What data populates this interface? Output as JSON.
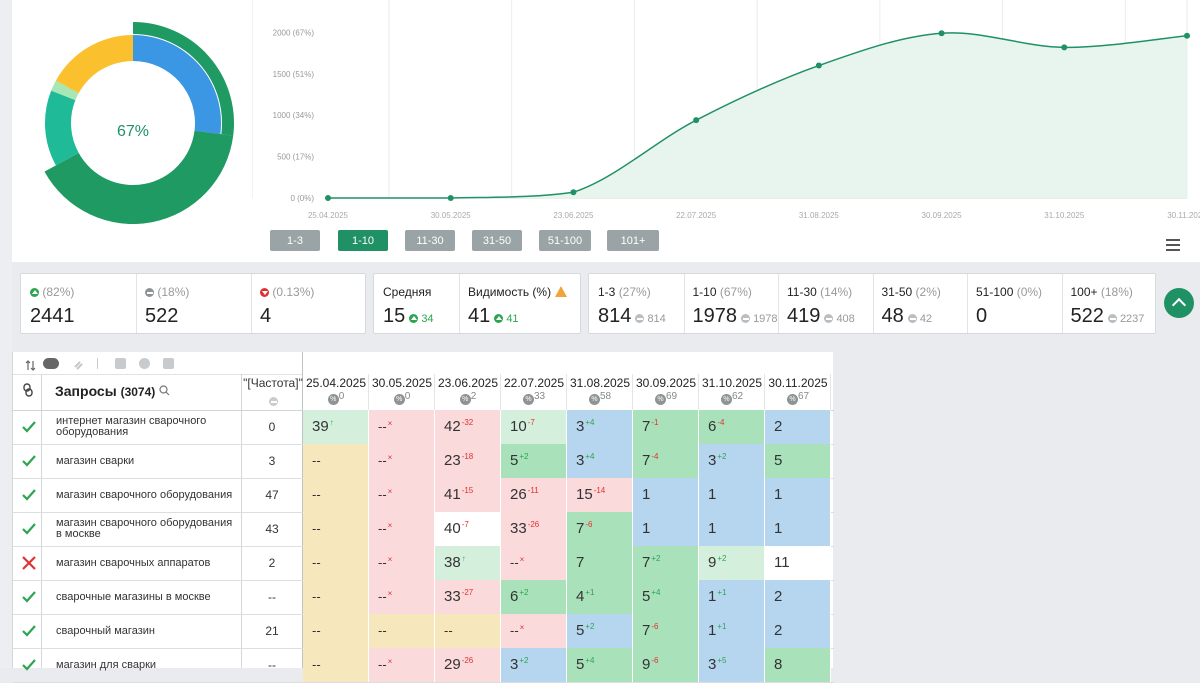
{
  "donut": {
    "center_label": "67%",
    "segments": [
      {
        "name": "1-3",
        "value": 27,
        "color": "#3b97e3"
      },
      {
        "name": "1-10",
        "value": 40,
        "color": "#1f9a62"
      },
      {
        "name": "11-30",
        "value": 14,
        "color": "#1fba98"
      },
      {
        "name": "31-50",
        "value": 2,
        "color": "#a8e6b4"
      },
      {
        "name": "51-100",
        "value": 17,
        "color": "#fbc02d"
      }
    ]
  },
  "chart_data": {
    "type": "area",
    "x": [
      "25.04.2025",
      "30.05.2025",
      "23.06.2025",
      "22.07.2025",
      "31.08.2025",
      "30.09.2025",
      "31.10.2025",
      "30.11.2025"
    ],
    "values": [
      0,
      0,
      70,
      940,
      1600,
      1990,
      1820,
      1960
    ],
    "y_ticks": [
      "0 (0%)",
      "500 (17%)",
      "1000 (34%)",
      "1500 (51%)",
      "2000 (67%)"
    ],
    "y_tick_values": [
      0,
      500,
      1000,
      1500,
      2000
    ],
    "ylim": [
      0,
      2150
    ],
    "grid": true,
    "line_color": "#1f9165",
    "fill_color": "#e8f5ee"
  },
  "range_buttons": [
    "1-3",
    "1-10",
    "11-30",
    "31-50",
    "51-100",
    "101+"
  ],
  "active_range": "1-10",
  "stats_left": [
    {
      "icon": "up",
      "pct": "(82%)",
      "value": "2441"
    },
    {
      "icon": "eq",
      "pct": "(18%)",
      "value": "522"
    },
    {
      "icon": "dn",
      "pct": "(0.13%)",
      "value": "4"
    }
  ],
  "stats_mid": [
    {
      "label": "Средняя",
      "value": "15",
      "delta": "34"
    },
    {
      "label": "Видимость (%)",
      "value": "41",
      "delta": "41"
    }
  ],
  "stats_ranges": [
    {
      "label": "1-3",
      "pct": "(27%)",
      "value": "814",
      "prev": "814"
    },
    {
      "label": "1-10",
      "pct": "(67%)",
      "value": "1978",
      "prev": "1978"
    },
    {
      "label": "11-30",
      "pct": "(14%)",
      "value": "419",
      "prev": "408"
    },
    {
      "label": "31-50",
      "pct": "(2%)",
      "value": "48",
      "prev": "42"
    },
    {
      "label": "51-100",
      "pct": "(0%)",
      "value": "0",
      "prev": ""
    },
    {
      "label": "100+",
      "pct": "(18%)",
      "value": "522",
      "prev": "2237"
    }
  ],
  "table": {
    "queries_label": "Запросы",
    "queries_count": "(3074)",
    "freq_header": "\"[Частота]\"",
    "dates": [
      {
        "date": "25.04.2025",
        "sub": "0"
      },
      {
        "date": "30.05.2025",
        "sub": "0"
      },
      {
        "date": "23.06.2025",
        "sub": "2"
      },
      {
        "date": "22.07.2025",
        "sub": "33"
      },
      {
        "date": "31.08.2025",
        "sub": "58"
      },
      {
        "date": "30.09.2025",
        "sub": "69"
      },
      {
        "date": "31.10.2025",
        "sub": "62"
      },
      {
        "date": "30.11.2025",
        "sub": "67"
      }
    ],
    "rows": [
      {
        "status": "ok",
        "keyword": "интернет магазин сварочного оборудования",
        "freq": "0",
        "cells": [
          {
            "v": "39",
            "d": "↑",
            "dc": "g",
            "c": "lgr"
          },
          {
            "v": "--",
            "d": "×",
            "dc": "r",
            "c": "red"
          },
          {
            "v": "42",
            "d": "-32",
            "dc": "r",
            "c": "red"
          },
          {
            "v": "10",
            "d": "-7",
            "dc": "r",
            "c": "lgr"
          },
          {
            "v": "3",
            "d": "+4",
            "dc": "g",
            "c": "blu"
          },
          {
            "v": "7",
            "d": "-1",
            "dc": "r",
            "c": "grn"
          },
          {
            "v": "6",
            "d": "-4",
            "dc": "r",
            "c": "grn"
          },
          {
            "v": "2",
            "d": "",
            "dc": "g",
            "c": "blu"
          }
        ]
      },
      {
        "status": "ok",
        "keyword": "магазин сварки",
        "freq": "3",
        "cells": [
          {
            "v": "--",
            "d": "",
            "dc": "g",
            "c": "yel"
          },
          {
            "v": "--",
            "d": "×",
            "dc": "r",
            "c": "red"
          },
          {
            "v": "23",
            "d": "-18",
            "dc": "r",
            "c": "red"
          },
          {
            "v": "5",
            "d": "+2",
            "dc": "g",
            "c": "grn"
          },
          {
            "v": "3",
            "d": "+4",
            "dc": "g",
            "c": "blu"
          },
          {
            "v": "7",
            "d": "-4",
            "dc": "r",
            "c": "grn"
          },
          {
            "v": "3",
            "d": "+2",
            "dc": "g",
            "c": "blu"
          },
          {
            "v": "5",
            "d": "",
            "dc": "g",
            "c": "grn"
          }
        ]
      },
      {
        "status": "ok",
        "keyword": "магазин сварочного оборудования",
        "freq": "47",
        "cells": [
          {
            "v": "--",
            "d": "",
            "dc": "g",
            "c": "yel"
          },
          {
            "v": "--",
            "d": "×",
            "dc": "r",
            "c": "red"
          },
          {
            "v": "41",
            "d": "-15",
            "dc": "r",
            "c": "red"
          },
          {
            "v": "26",
            "d": "-11",
            "dc": "r",
            "c": "red"
          },
          {
            "v": "15",
            "d": "-14",
            "dc": "r",
            "c": "red"
          },
          {
            "v": "1",
            "d": "",
            "dc": "g",
            "c": "blu"
          },
          {
            "v": "1",
            "d": "",
            "dc": "g",
            "c": "blu"
          },
          {
            "v": "1",
            "d": "",
            "dc": "g",
            "c": "blu"
          }
        ]
      },
      {
        "status": "ok",
        "keyword": "магазин сварочного оборудования в москве",
        "freq": "43",
        "cells": [
          {
            "v": "--",
            "d": "",
            "dc": "g",
            "c": "yel"
          },
          {
            "v": "--",
            "d": "×",
            "dc": "r",
            "c": "red"
          },
          {
            "v": "40",
            "d": "-7",
            "dc": "r",
            "c": "wht"
          },
          {
            "v": "33",
            "d": "-26",
            "dc": "r",
            "c": "red"
          },
          {
            "v": "7",
            "d": "-6",
            "dc": "r",
            "c": "grn"
          },
          {
            "v": "1",
            "d": "",
            "dc": "g",
            "c": "blu"
          },
          {
            "v": "1",
            "d": "",
            "dc": "g",
            "c": "blu"
          },
          {
            "v": "1",
            "d": "",
            "dc": "g",
            "c": "blu"
          }
        ]
      },
      {
        "status": "bad",
        "keyword": "магазин сварочных аппаратов",
        "freq": "2",
        "cells": [
          {
            "v": "--",
            "d": "",
            "dc": "g",
            "c": "yel"
          },
          {
            "v": "--",
            "d": "×",
            "dc": "r",
            "c": "red"
          },
          {
            "v": "38",
            "d": "↑",
            "dc": "g",
            "c": "lgr"
          },
          {
            "v": "--",
            "d": "×",
            "dc": "r",
            "c": "red"
          },
          {
            "v": "7",
            "d": "",
            "dc": "g",
            "c": "grn"
          },
          {
            "v": "7",
            "d": "+2",
            "dc": "g",
            "c": "grn"
          },
          {
            "v": "9",
            "d": "+2",
            "dc": "g",
            "c": "lgr"
          },
          {
            "v": "11",
            "d": "",
            "dc": "g",
            "c": "wht"
          }
        ]
      },
      {
        "status": "ok",
        "keyword": "сварочные магазины в москве",
        "freq": "--",
        "cells": [
          {
            "v": "--",
            "d": "",
            "dc": "g",
            "c": "yel"
          },
          {
            "v": "--",
            "d": "×",
            "dc": "r",
            "c": "red"
          },
          {
            "v": "33",
            "d": "-27",
            "dc": "r",
            "c": "red"
          },
          {
            "v": "6",
            "d": "+2",
            "dc": "g",
            "c": "grn"
          },
          {
            "v": "4",
            "d": "+1",
            "dc": "g",
            "c": "grn"
          },
          {
            "v": "5",
            "d": "+4",
            "dc": "g",
            "c": "grn"
          },
          {
            "v": "1",
            "d": "+1",
            "dc": "g",
            "c": "blu"
          },
          {
            "v": "2",
            "d": "",
            "dc": "g",
            "c": "blu"
          }
        ]
      },
      {
        "status": "ok",
        "keyword": "сварочный магазин",
        "freq": "21",
        "cells": [
          {
            "v": "--",
            "d": "",
            "dc": "g",
            "c": "yel"
          },
          {
            "v": "--",
            "d": "",
            "dc": "g",
            "c": "yel"
          },
          {
            "v": "--",
            "d": "",
            "dc": "g",
            "c": "yel"
          },
          {
            "v": "--",
            "d": "×",
            "dc": "r",
            "c": "red"
          },
          {
            "v": "5",
            "d": "+2",
            "dc": "g",
            "c": "blu"
          },
          {
            "v": "7",
            "d": "-6",
            "dc": "r",
            "c": "grn"
          },
          {
            "v": "1",
            "d": "+1",
            "dc": "g",
            "c": "blu"
          },
          {
            "v": "2",
            "d": "",
            "dc": "g",
            "c": "blu"
          }
        ]
      },
      {
        "status": "ok",
        "keyword": "магазин для сварки",
        "freq": "--",
        "cells": [
          {
            "v": "--",
            "d": "",
            "dc": "g",
            "c": "yel"
          },
          {
            "v": "--",
            "d": "×",
            "dc": "r",
            "c": "red"
          },
          {
            "v": "29",
            "d": "-26",
            "dc": "r",
            "c": "red"
          },
          {
            "v": "3",
            "d": "+2",
            "dc": "g",
            "c": "blu"
          },
          {
            "v": "5",
            "d": "+4",
            "dc": "g",
            "c": "grn"
          },
          {
            "v": "9",
            "d": "-6",
            "dc": "r",
            "c": "grn"
          },
          {
            "v": "3",
            "d": "+5",
            "dc": "g",
            "c": "blu"
          },
          {
            "v": "8",
            "d": "",
            "dc": "g",
            "c": "grn"
          }
        ]
      }
    ]
  }
}
